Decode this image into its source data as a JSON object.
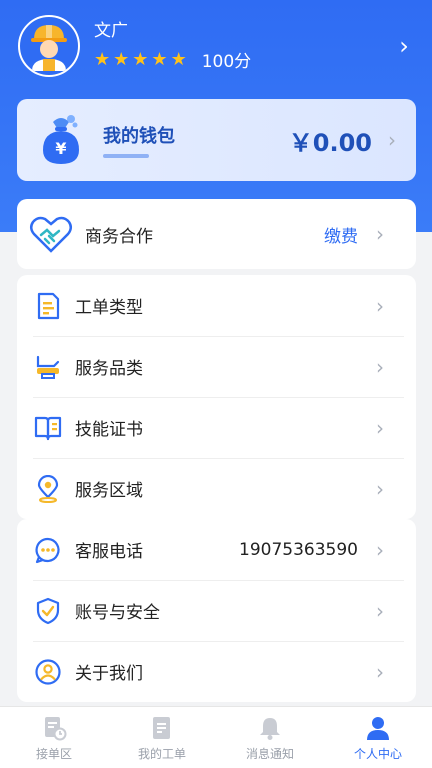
{
  "profile": {
    "name": "文广",
    "stars": [
      "★",
      "★",
      "★",
      "★",
      "★"
    ],
    "score": "100分"
  },
  "wallet": {
    "label": "我的钱包",
    "balance": "￥0.00",
    "icon_glyph": "¥"
  },
  "business": {
    "label": "商务合作",
    "value": "缴费"
  },
  "menu_group_1": [
    {
      "label": "工单类型",
      "icon": "order-type-icon"
    },
    {
      "label": "服务品类",
      "icon": "service-category-icon"
    },
    {
      "label": "技能证书",
      "icon": "certificate-book-icon"
    },
    {
      "label": "服务区域",
      "icon": "location-pin-icon"
    }
  ],
  "menu_group_2": [
    {
      "label": "客服电话",
      "value": "19075363590",
      "icon": "chat-bubble-icon"
    },
    {
      "label": "账号与安全",
      "icon": "shield-check-icon"
    },
    {
      "label": "关于我们",
      "icon": "user-circle-icon"
    }
  ],
  "tabs": [
    {
      "label": "接单区",
      "icon": "document-clock-icon"
    },
    {
      "label": "我的工单",
      "icon": "document-icon"
    },
    {
      "label": "消息通知",
      "icon": "bell-icon"
    },
    {
      "label": "个人中心",
      "icon": "person-icon"
    }
  ],
  "colors": {
    "primary": "#2f6cf3",
    "star": "#ffc21a",
    "icon_blue": "#2f6cf3",
    "icon_yellow": "#f5b82a"
  }
}
